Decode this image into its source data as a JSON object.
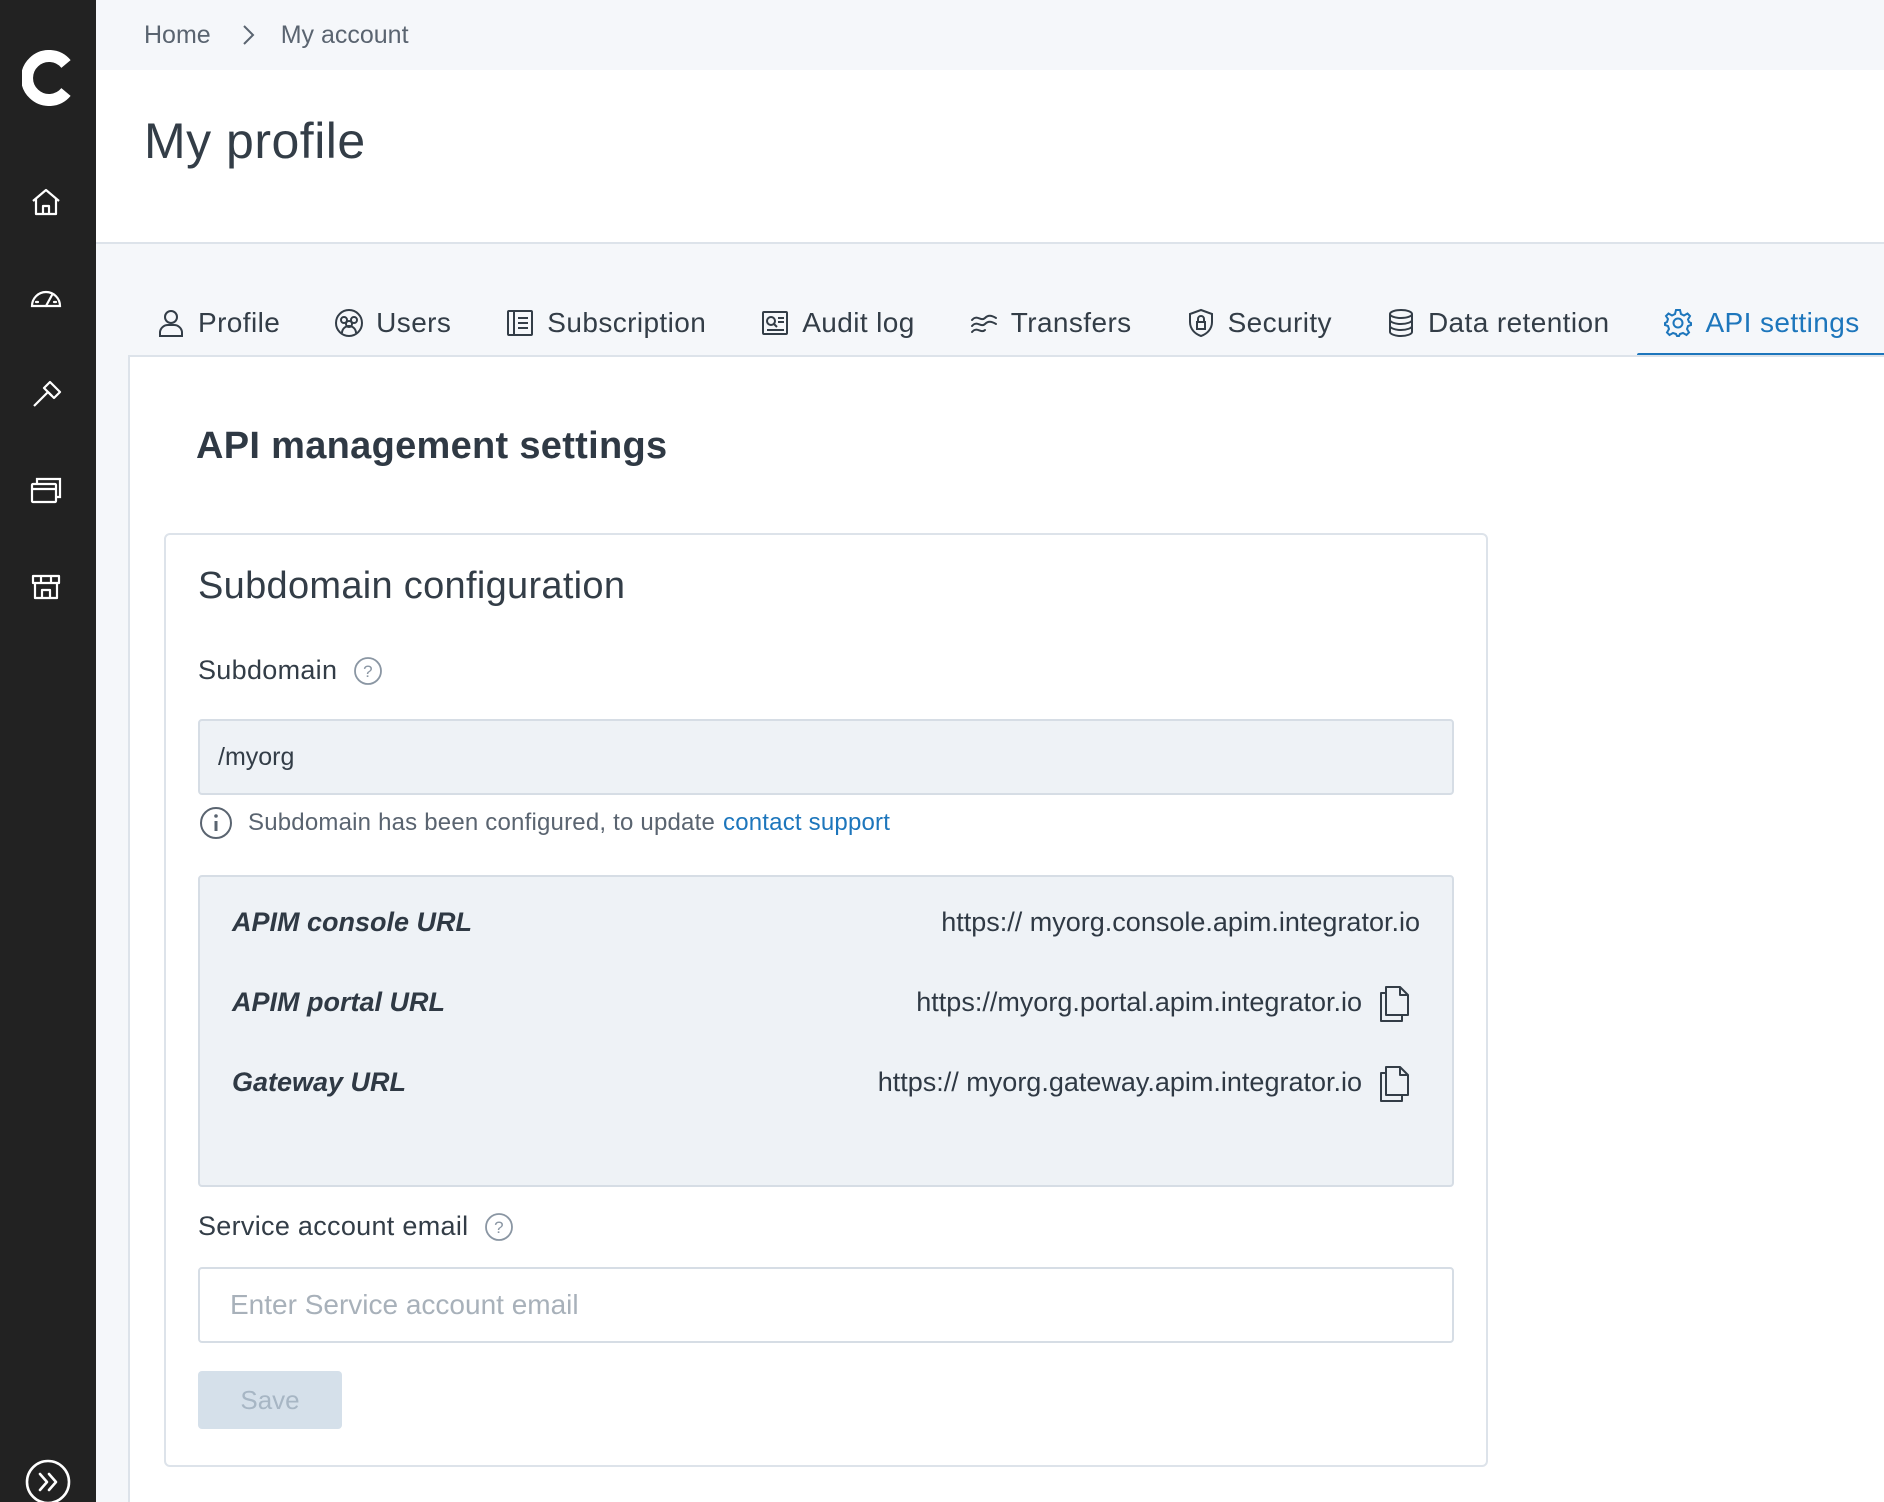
{
  "app": {
    "logo_letter": "C",
    "sidebar": [
      {
        "icon": "home-icon"
      },
      {
        "icon": "dashboard-icon"
      },
      {
        "icon": "tools-icon"
      },
      {
        "icon": "windows-icon"
      },
      {
        "icon": "marketplace-icon"
      }
    ]
  },
  "breadcrumb": {
    "home": "Home",
    "current": "My account"
  },
  "page": {
    "title": "My profile"
  },
  "tabs": [
    {
      "label": "Profile",
      "icon": "user-icon",
      "active": false
    },
    {
      "label": "Users",
      "icon": "users-icon",
      "active": false
    },
    {
      "label": "Subscription",
      "icon": "subscription-icon",
      "active": false
    },
    {
      "label": "Audit log",
      "icon": "audit-log-icon",
      "active": false
    },
    {
      "label": "Transfers",
      "icon": "transfers-icon",
      "active": false
    },
    {
      "label": "Security",
      "icon": "shield-icon",
      "active": false
    },
    {
      "label": "Data retention",
      "icon": "database-icon",
      "active": false
    },
    {
      "label": "API settings",
      "icon": "gear-icon",
      "active": true
    }
  ],
  "main": {
    "section_title": "API management settings",
    "card": {
      "title": "Subdomain configuration",
      "subdomain_label": "Subdomain",
      "subdomain_value": "/myorg",
      "info_text": "Subdomain has been configured, to update",
      "info_link": "contact support",
      "urls": [
        {
          "label": "APIM console URL",
          "value": "https:// myorg.console.apim.integrator.io",
          "copy": false
        },
        {
          "label": "APIM portal URL",
          "value": "https://myorg.portal.apim.integrator.io",
          "copy": true
        },
        {
          "label": "Gateway URL",
          "value": "https:// myorg.gateway.apim.integrator.io",
          "copy": true
        }
      ],
      "email_label": "Service account email",
      "email_placeholder": "Enter Service account email",
      "email_value": "",
      "save_label": "Save"
    }
  },
  "colors": {
    "accent": "#1d76bc",
    "sidebar_bg": "#222222",
    "panel_bg": "#eef2f6"
  }
}
